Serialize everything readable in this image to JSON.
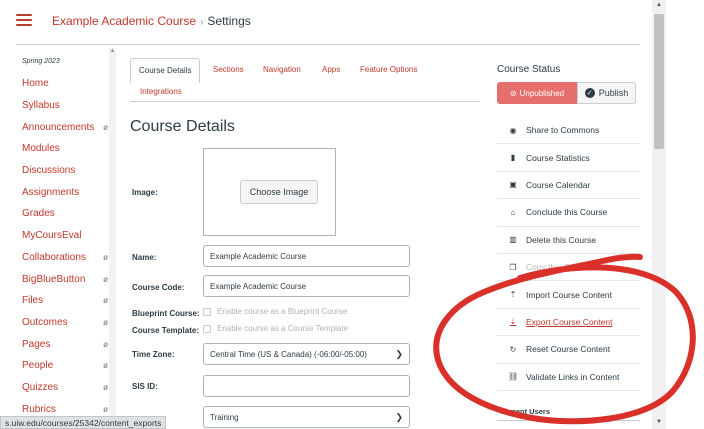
{
  "header": {
    "course_name": "Example Academic Course",
    "separator": "›",
    "current_page": "Settings"
  },
  "nav": {
    "term": "Spring 2023",
    "items": [
      {
        "label": "Home",
        "hidden": false
      },
      {
        "label": "Syllabus",
        "hidden": false
      },
      {
        "label": "Announcements",
        "hidden": true
      },
      {
        "label": "Modules",
        "hidden": false
      },
      {
        "label": "Discussions",
        "hidden": false
      },
      {
        "label": "Assignments",
        "hidden": false
      },
      {
        "label": "Grades",
        "hidden": false
      },
      {
        "label": "MyCoursEval",
        "hidden": false
      },
      {
        "label": "Collaborations",
        "hidden": true
      },
      {
        "label": "BigBlueButton",
        "hidden": true
      },
      {
        "label": "Files",
        "hidden": true
      },
      {
        "label": "Outcomes",
        "hidden": true
      },
      {
        "label": "Pages",
        "hidden": true
      },
      {
        "label": "People",
        "hidden": true
      },
      {
        "label": "Quizzes",
        "hidden": true
      },
      {
        "label": "Rubrics",
        "hidden": true
      }
    ],
    "hidden_icon": "eye-slash-icon"
  },
  "tabs": [
    "Course Details",
    "Sections",
    "Navigation",
    "Apps",
    "Feature Options",
    "Integrations"
  ],
  "main": {
    "title": "Course Details",
    "image_label": "Image:",
    "choose_image": "Choose Image",
    "name_label": "Name:",
    "name_value": "Example Academic Course",
    "code_label": "Course Code:",
    "code_value": "Example Academic Course",
    "blueprint_label": "Blueprint Course:",
    "blueprint_text": "Enable course as a Blueprint Course",
    "template_label": "Course Template:",
    "template_text": "Enable course as a Course Template",
    "timezone_label": "Time Zone:",
    "timezone_value": "Central Time (US & Canada) (-06:00/-05:00)",
    "sisid_label": "SIS ID:",
    "sisid_value": "",
    "subaccount_value": "Training"
  },
  "sidebar": {
    "status_title": "Course Status",
    "unpublished": "Unpublished",
    "publish": "Publish",
    "items": [
      {
        "label": "Share to Commons",
        "icon": "commons-icon"
      },
      {
        "label": "Course Statistics",
        "icon": "bar-chart-icon"
      },
      {
        "label": "Course Calendar",
        "icon": "calendar-icon"
      },
      {
        "label": "Conclude this Course",
        "icon": "lock-icon"
      },
      {
        "label": "Delete this Course",
        "icon": "trash-icon"
      },
      {
        "label": "Copy this Course",
        "icon": "copy-icon"
      },
      {
        "label": "Import Course Content",
        "icon": "upload-icon"
      },
      {
        "label": "Export Course Content",
        "icon": "download-icon"
      },
      {
        "label": "Reset Course Content",
        "icon": "reset-icon"
      },
      {
        "label": "Validate Links in Content",
        "icon": "link-icon"
      }
    ],
    "current_users": "Current Users"
  },
  "status_url": "s.uiw.edu/courses/25342/content_exports",
  "colors": {
    "accent": "#c0392b",
    "unpublished_bg": "#e66f6b",
    "text": "#2d3b45",
    "annotation": "#d9302a"
  }
}
